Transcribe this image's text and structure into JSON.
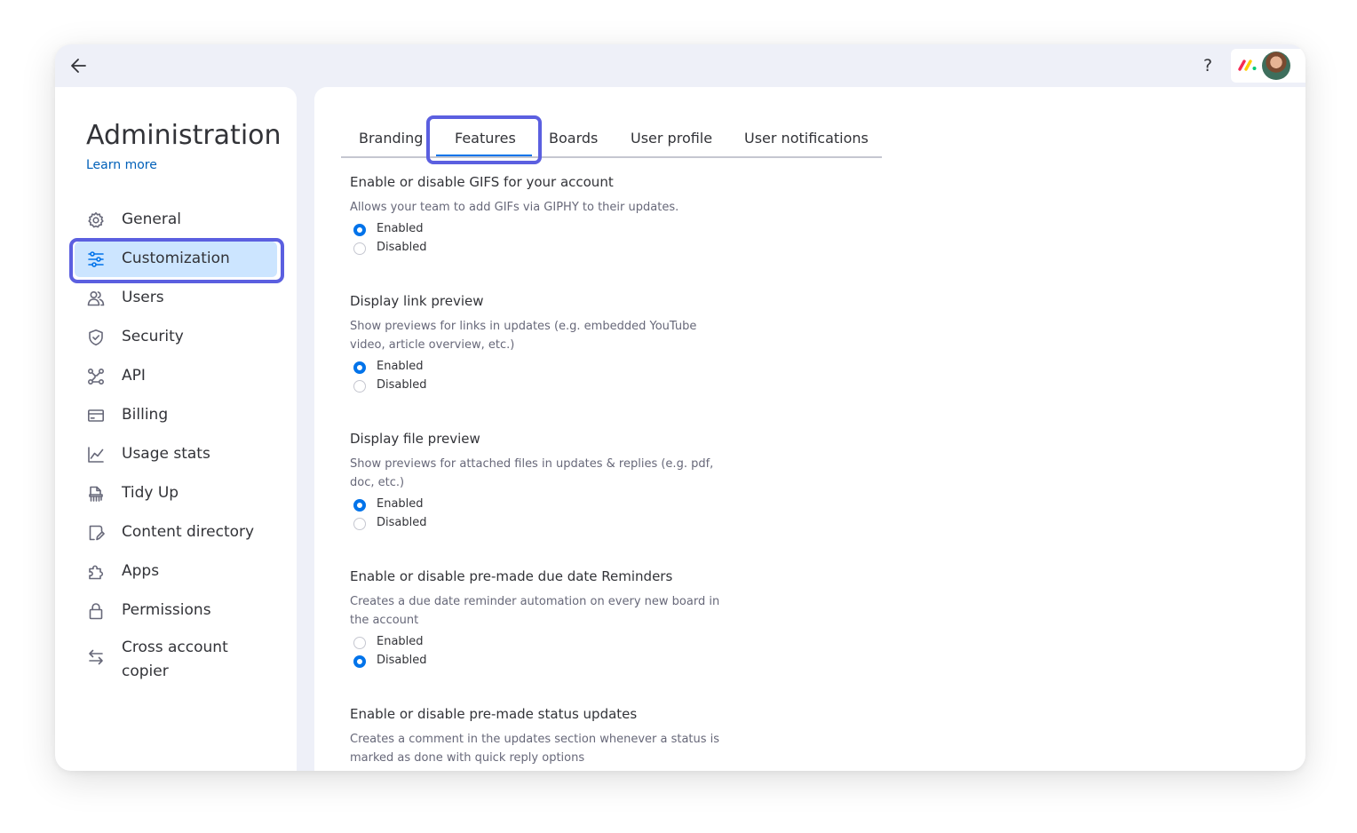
{
  "window": {
    "help_label": "?",
    "brand_colors": [
      "#f62b54",
      "#ffcc00",
      "#00ca72"
    ]
  },
  "sidebar": {
    "title": "Administration",
    "learn_more": "Learn more",
    "items": [
      {
        "label": "General",
        "icon": "gear-icon",
        "active": false
      },
      {
        "label": "Customization",
        "icon": "sliders-icon",
        "active": true
      },
      {
        "label": "Users",
        "icon": "users-icon",
        "active": false
      },
      {
        "label": "Security",
        "icon": "shield-icon",
        "active": false
      },
      {
        "label": "API",
        "icon": "api-icon",
        "active": false
      },
      {
        "label": "Billing",
        "icon": "credit-card-icon",
        "active": false
      },
      {
        "label": "Usage stats",
        "icon": "chart-icon",
        "active": false
      },
      {
        "label": "Tidy Up",
        "icon": "tidy-up-icon",
        "active": false
      },
      {
        "label": "Content directory",
        "icon": "content-directory-icon",
        "active": false
      },
      {
        "label": "Apps",
        "icon": "puzzle-icon",
        "active": false
      },
      {
        "label": "Permissions",
        "icon": "lock-icon",
        "active": false
      },
      {
        "label": "Cross account copier",
        "icon": "arrows-swap-icon",
        "active": false
      }
    ]
  },
  "tabs": [
    {
      "label": "Branding",
      "active": false
    },
    {
      "label": "Features",
      "active": true
    },
    {
      "label": "Boards",
      "active": false
    },
    {
      "label": "User profile",
      "active": false
    },
    {
      "label": "User notifications",
      "active": false
    }
  ],
  "sections": [
    {
      "title": "Enable or disable GIFS for your account",
      "description": "Allows your team to add GIFs via GIPHY to their updates.",
      "options": [
        {
          "label": "Enabled",
          "checked": true
        },
        {
          "label": "Disabled",
          "checked": false
        }
      ]
    },
    {
      "title": "Display link preview",
      "description": "Show previews for links in updates (e.g. embedded YouTube video, article overview, etc.)",
      "options": [
        {
          "label": "Enabled",
          "checked": true
        },
        {
          "label": "Disabled",
          "checked": false
        }
      ]
    },
    {
      "title": "Display file preview",
      "description": "Show previews for attached files in updates & replies (e.g. pdf, doc, etc.)",
      "options": [
        {
          "label": "Enabled",
          "checked": true
        },
        {
          "label": "Disabled",
          "checked": false
        }
      ]
    },
    {
      "title": "Enable or disable pre-made due date Reminders",
      "description": "Creates a due date reminder automation on every new board in the account",
      "options": [
        {
          "label": "Enabled",
          "checked": false
        },
        {
          "label": "Disabled",
          "checked": true
        }
      ]
    },
    {
      "title": "Enable or disable pre-made status updates",
      "description": "Creates a comment in the updates section whenever a status is marked as done with quick reply options",
      "options": []
    }
  ]
}
